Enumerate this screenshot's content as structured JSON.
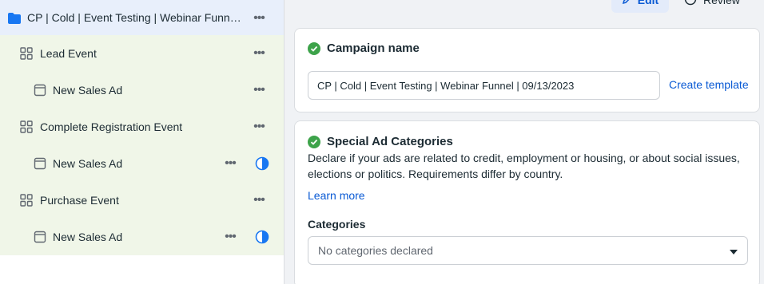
{
  "toolbar": {
    "edit_label": "Edit",
    "review_label": "Review"
  },
  "tree": {
    "campaign": {
      "label": "CP | Cold | Event Testing | Webinar Funne...",
      "icon": "folder-icon"
    },
    "ad_sets": [
      {
        "label": "Lead Event",
        "icon": "grid-icon",
        "ads": [
          {
            "label": "New Sales Ad",
            "icon": "ad-icon",
            "status": ""
          }
        ]
      },
      {
        "label": "Complete Registration Event",
        "icon": "grid-icon",
        "ads": [
          {
            "label": "New Sales Ad",
            "icon": "ad-icon",
            "status": "half-circle-icon"
          }
        ]
      },
      {
        "label": "Purchase Event",
        "icon": "grid-icon",
        "ads": [
          {
            "label": "New Sales Ad",
            "icon": "ad-icon",
            "status": "half-circle-icon"
          }
        ]
      }
    ],
    "more_label": "•••"
  },
  "campaign_card": {
    "title": "Campaign name",
    "name_value": "CP | Cold | Event Testing | Webinar Funnel | 09/13/2023",
    "create_template_label": "Create template"
  },
  "special_card": {
    "title": "Special Ad Categories",
    "description": "Declare if your ads are related to credit, employment or housing, or about social issues, elections or politics. Requirements differ by country.",
    "learn_more_label": "Learn more",
    "categories_label": "Categories",
    "categories_placeholder": "No categories declared"
  },
  "colors": {
    "accent": "#0a5ad4",
    "success": "#3da34a",
    "campaign_row_bg": "#e8effb",
    "adset_row_bg": "#f0f6e8"
  }
}
